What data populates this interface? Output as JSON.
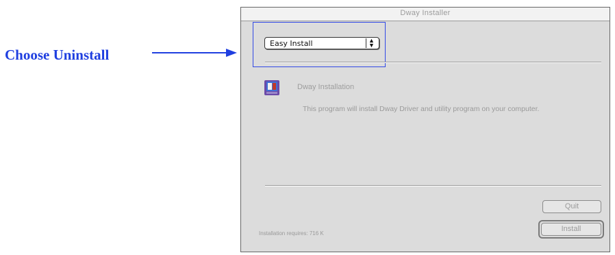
{
  "annotation": {
    "label": "Choose Uninstall",
    "color": "#1f3fe0"
  },
  "window": {
    "title": "Dway Installer",
    "popup": {
      "selected": "Easy Install",
      "arrows_icon": "updown-arrows-icon"
    },
    "heading": "Dway Installation",
    "description": "This program will install Dway Driver and utility program on your computer.",
    "quit_label": "Quit",
    "install_label": "Install",
    "footer_text": "Installation requires: 716 K",
    "highlight_color": "#3048e6"
  }
}
